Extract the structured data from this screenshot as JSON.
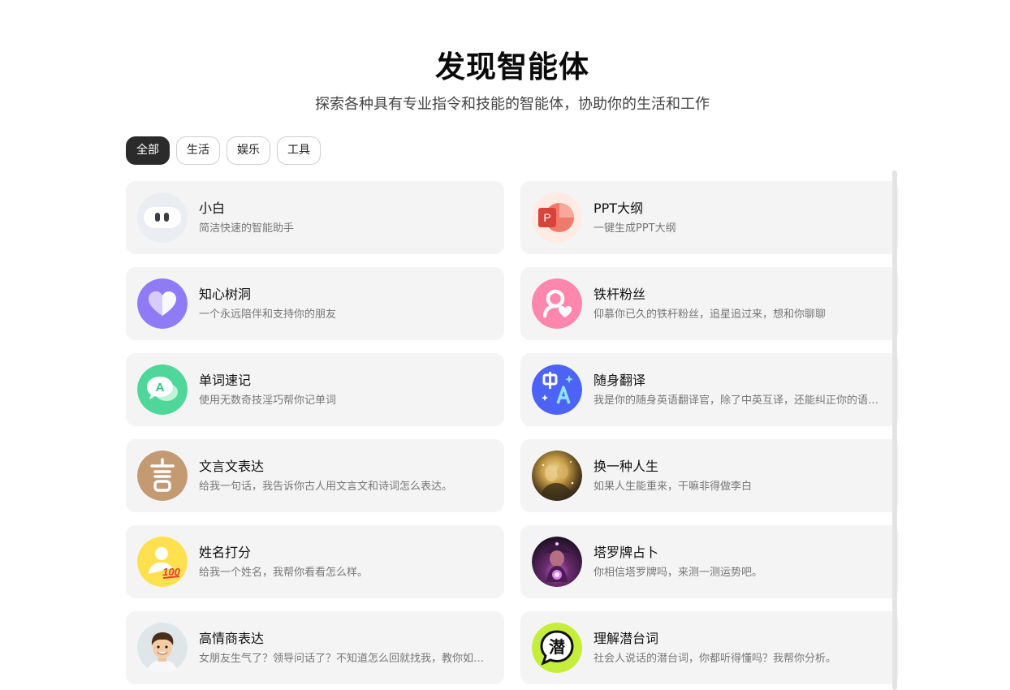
{
  "header": {
    "title": "发现智能体",
    "subtitle": "探索各种具有专业指令和技能的智能体，协助你的生活和工作"
  },
  "filters": [
    {
      "label": "全部",
      "active": true
    },
    {
      "label": "生活",
      "active": false
    },
    {
      "label": "娱乐",
      "active": false
    },
    {
      "label": "工具",
      "active": false
    }
  ],
  "agents": [
    {
      "name": "小白",
      "desc": "简洁快速的智能助手",
      "icon": "robot-face-icon"
    },
    {
      "name": "PPT大纲",
      "desc": "一键生成PPT大纲",
      "icon": "powerpoint-icon"
    },
    {
      "name": "知心树洞",
      "desc": "一个永远陪伴和支持你的朋友",
      "icon": "heart-icon"
    },
    {
      "name": "铁杆粉丝",
      "desc": "仰慕你已久的铁杆粉丝，追星追过来，想和你聊聊",
      "icon": "fan-person-heart-icon"
    },
    {
      "name": "单词速记",
      "desc": "使用无数奇技淫巧帮你记单词",
      "icon": "chat-letter-a-icon"
    },
    {
      "name": "随身翻译",
      "desc": "我是你的随身英语翻译官，除了中英互译，还能纠正你的语法和用词哦",
      "icon": "translate-icon"
    },
    {
      "name": "文言文表达",
      "desc": "给我一句话，我告诉你古人用文言文和诗词怎么表达。",
      "icon": "classical-character-icon"
    },
    {
      "name": "换一种人生",
      "desc": "如果人生能重来，干嘛非得做李白",
      "icon": "golden-portrait-image"
    },
    {
      "name": "姓名打分",
      "desc": "给我一个姓名，我帮你看看怎么样。",
      "icon": "person-score-100-icon"
    },
    {
      "name": "塔罗牌占卜",
      "desc": "你相信塔罗牌吗，来测一测运势吧。",
      "icon": "tarot-reader-image"
    },
    {
      "name": "高情商表达",
      "desc": "女朋友生气了？领导问话了？不知道怎么回就找我，教你如何高情商回复。",
      "icon": "smiling-boy-avatar"
    },
    {
      "name": "理解潜台词",
      "desc": "社会人说话的潜台词，你都听得懂吗？我帮你分析。",
      "icon": "subtext-bubble-icon"
    }
  ],
  "colors": {
    "card_bg": "#f4f4f5",
    "active_chip": "#2b2b2b",
    "heart_purple": "#8f7bf5",
    "fan_pink": "#ff86ad",
    "word_green": "#4fd79a",
    "translate_blue": "#4d63f5",
    "classical_brown": "#c39a72",
    "score_yellow": "#ffe04f",
    "subtext_lime": "#c5ee3b"
  }
}
